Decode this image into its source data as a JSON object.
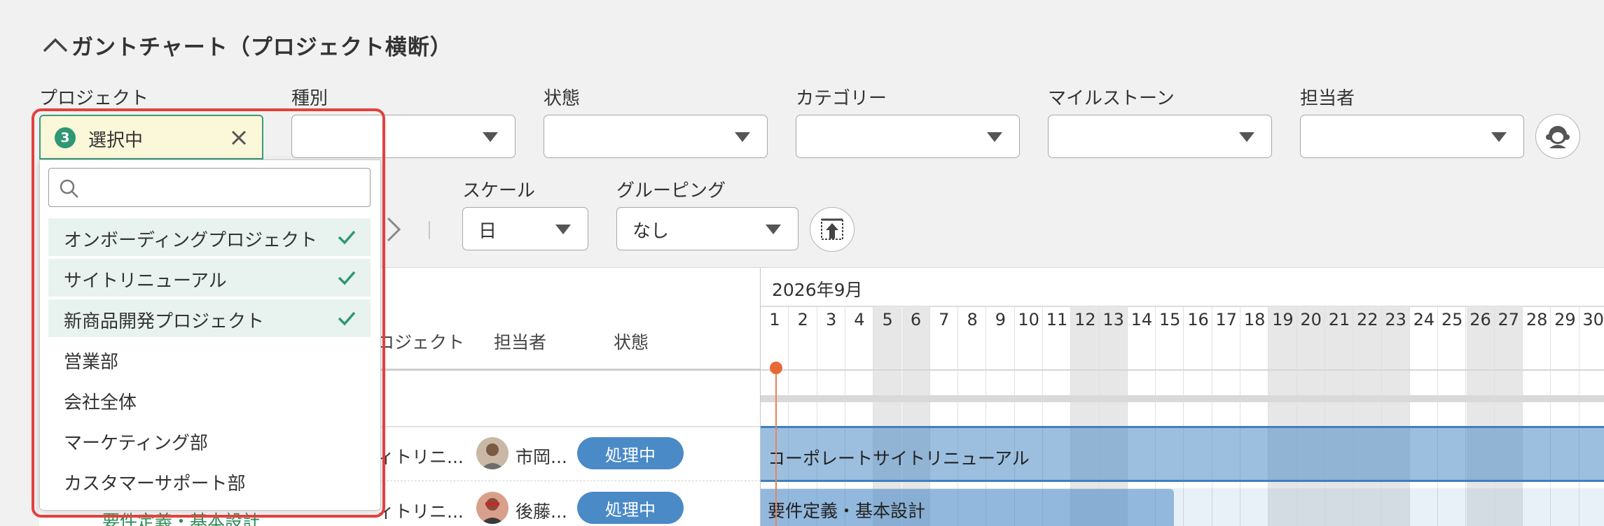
{
  "header": {
    "title": "ガントチャート（プロジェクト横断）"
  },
  "filters": {
    "project": {
      "label": "プロジェクト",
      "selected_count": "3",
      "selected_text": "選択中"
    },
    "type": {
      "label": "種別"
    },
    "status": {
      "label": "状態"
    },
    "category": {
      "label": "カテゴリー"
    },
    "milestone": {
      "label": "マイルストーン"
    },
    "assignee": {
      "label": "担当者"
    }
  },
  "view": {
    "scale": {
      "label": "スケール",
      "value": "日"
    },
    "grouping": {
      "label": "グルーピング",
      "value": "なし"
    }
  },
  "project_dropdown": {
    "search_placeholder": "",
    "options": [
      {
        "label": "オンボーディングプロジェクト",
        "checked": true
      },
      {
        "label": "サイトリニューアル",
        "checked": true
      },
      {
        "label": "新商品開発プロジェクト",
        "checked": true
      },
      {
        "label": "営業部",
        "checked": false
      },
      {
        "label": "会社全体",
        "checked": false
      },
      {
        "label": "マーケティング部",
        "checked": false
      },
      {
        "label": "カスタマーサポート部",
        "checked": false
      }
    ]
  },
  "table": {
    "columns": {
      "project": "ロジェクト",
      "assignee": "担当者",
      "status": "状態"
    },
    "rows": [
      {
        "project": "ィトリニ...",
        "assignee": "市岡...",
        "status": "処理中"
      },
      {
        "project": "ィトリニ...",
        "assignee": "後藤...",
        "status": "処理中"
      }
    ],
    "partial_task": "要件定義・基本設計"
  },
  "gantt": {
    "month": "2026年9月",
    "days": [
      "1",
      "2",
      "3",
      "4",
      "5",
      "6",
      "7",
      "8",
      "9",
      "10",
      "11",
      "12",
      "13",
      "14",
      "15",
      "16",
      "17",
      "18",
      "19",
      "20",
      "21",
      "22",
      "23",
      "24",
      "25",
      "26",
      "27",
      "28",
      "29",
      "30"
    ],
    "weekend_days": [
      5,
      6,
      12,
      13,
      19,
      20,
      21,
      22,
      23,
      26,
      27
    ],
    "bars": [
      {
        "label": "コーポレートサイトリニューアル"
      },
      {
        "label": "要件定義・基本設計"
      }
    ],
    "colors": {
      "bar": "#4a8ac6",
      "today": "#e66a35"
    }
  }
}
